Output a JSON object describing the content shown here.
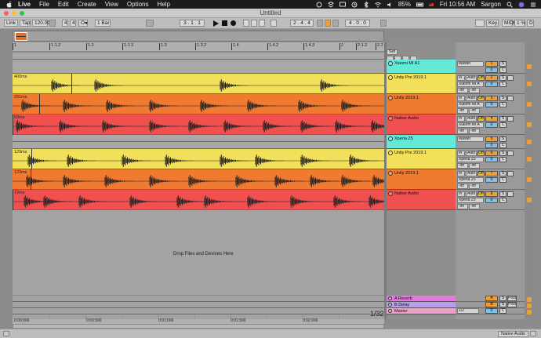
{
  "menubar": {
    "items": [
      "Live",
      "File",
      "Edit",
      "Create",
      "View",
      "Options",
      "Help"
    ],
    "battery": "85%",
    "clock": "Fri 10:56 AM",
    "user": "Sargon"
  },
  "window": {
    "title": "Untitled"
  },
  "control": {
    "link": "Link",
    "tap": "Tap",
    "tempo": "120.00",
    "sig_num": "4",
    "sig_den": "4",
    "quantize": "1 Bar",
    "position": "3 . 1 . 1",
    "loop_start": "2 . 4 . 4",
    "loop_length": "4 . 0 . 0",
    "key": "Key",
    "midi": "MIDI",
    "cpu": "1 %",
    "d": "D"
  },
  "ruler": {
    "ticks": [
      "1",
      "1.1.2",
      "1.2",
      "1.1.3",
      "1.3",
      "1.3.2",
      "1.4",
      "1.4.2",
      "1.4.3",
      "2",
      "2.1.2",
      "2.2"
    ]
  },
  "tracks": [
    {
      "name": "Xiaomi MI A1",
      "type": "group",
      "color": "#64e8d8",
      "clip_label": "",
      "output": "Master",
      "num": "1",
      "input": "",
      "mon": ""
    },
    {
      "name": "Unity Pre 2019.1",
      "type": "audio",
      "color": "#f2e05a",
      "clip_label": "400ms",
      "output": "Xiaomi MI A",
      "num": "2",
      "input": "In",
      "mon": "Auto"
    },
    {
      "name": "Unity 2019.1",
      "type": "audio",
      "color": "#f07a30",
      "clip_label": "201ms",
      "output": "Xiaomi MI A",
      "num": "3",
      "input": "In",
      "mon": "Auto"
    },
    {
      "name": "Native Audio",
      "type": "audio",
      "color": "#f05050",
      "clip_label": "93ms",
      "output": "Xiaomi MI A",
      "num": "4",
      "input": "In",
      "mon": "Auto"
    },
    {
      "name": "Xperia Z5",
      "type": "group",
      "color": "#64e8d8",
      "clip_label": "",
      "output": "Master",
      "num": "5",
      "input": "",
      "mon": ""
    },
    {
      "name": "Unity Pre 2019.1",
      "type": "audio",
      "color": "#f2e05a",
      "clip_label": "129ms",
      "output": "Xperia Z5",
      "num": "6",
      "input": "In",
      "mon": "Auto"
    },
    {
      "name": "Unity 2019.1",
      "type": "audio",
      "color": "#f07a30",
      "clip_label": "123ms",
      "output": "Xperia Z5",
      "num": "7",
      "input": "In",
      "mon": "Auto"
    },
    {
      "name": "Native Audio",
      "type": "audio",
      "color": "#f05050",
      "clip_label": "72ms",
      "output": "Xperia Z5",
      "num": "8",
      "input": "In",
      "mon": "Auto"
    }
  ],
  "returns": [
    {
      "name": "A Reverb",
      "letter": "A",
      "post": "Post",
      "color": "#e478e0"
    },
    {
      "name": "B Delay",
      "letter": "B",
      "post": "Post",
      "color": "#b89cf0"
    }
  ],
  "master": {
    "name": "Master",
    "output": "1/2",
    "num": "0",
    "color": "#f0a0c8"
  },
  "mixer_labels": {
    "solo": "S",
    "off": "Off",
    "inf": "-inf",
    "zero": "0",
    "center": "C",
    "set": "Set"
  },
  "arrangement": {
    "drop_text": "Drop Files and Devices Here",
    "loop_display": "1/32",
    "time_ticks": [
      "0:00:000",
      "0:00:500",
      "0:01:000",
      "0:01:500",
      "0:02:000"
    ]
  },
  "statusbar": {
    "selected_track": "Native Audio"
  }
}
